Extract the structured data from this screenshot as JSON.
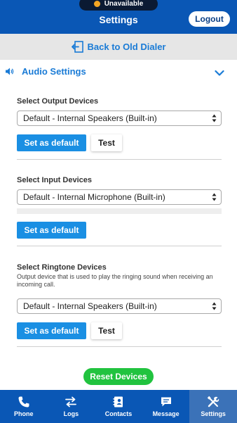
{
  "header": {
    "status": {
      "label": "Unavailable",
      "dot_color": "#f5a623"
    },
    "title": "Settings",
    "logout_label": "Logout",
    "bg_color": "#0a57b5"
  },
  "back_bar": {
    "label": "Back to Old Dialer",
    "icon": "exit-door-icon"
  },
  "audio_section": {
    "title": "Audio Settings",
    "icon": "speaker-icon",
    "expanded": true
  },
  "output_devices": {
    "label": "Select Output Devices",
    "selected": "Default - Internal Speakers (Built-in)",
    "set_default_label": "Set as default",
    "test_label": "Test"
  },
  "input_devices": {
    "label": "Select Input Devices",
    "selected": "Default - Internal Microphone (Built-in)",
    "set_default_label": "Set as default"
  },
  "ringtone_devices": {
    "label": "Select Ringtone Devices",
    "description": "Output device that is used to play the ringing sound when receiving an incoming call.",
    "selected": "Default - Internal Speakers (Built-in)",
    "set_default_label": "Set as default",
    "test_label": "Test"
  },
  "reset_label": "Reset Devices",
  "tabbar": {
    "active": "Settings",
    "tabs": [
      {
        "label": "Phone",
        "icon": "phone-icon"
      },
      {
        "label": "Logs",
        "icon": "logs-icon"
      },
      {
        "label": "Contacts",
        "icon": "contacts-icon"
      },
      {
        "label": "Message",
        "icon": "message-icon"
      },
      {
        "label": "Settings",
        "icon": "settings-tools-icon"
      }
    ]
  },
  "colors": {
    "accent_blue": "#1a8fe3",
    "link_blue": "#1a7bd6",
    "reset_green": "#21c33f",
    "active_tab": "#3b72b8"
  }
}
